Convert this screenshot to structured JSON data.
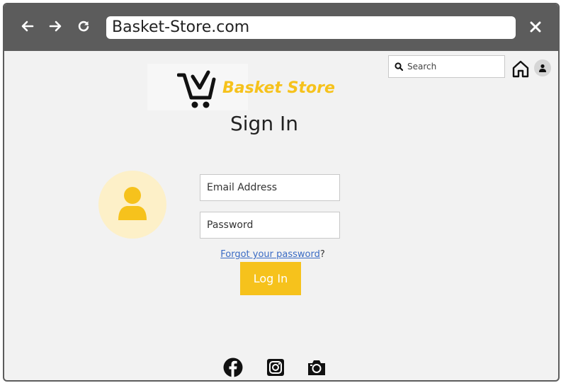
{
  "browser": {
    "url": "Basket-Store.com",
    "back_icon": "arrow-left-icon",
    "forward_icon": "arrow-right-icon",
    "reload_icon": "reload-icon",
    "close_icon": "close-icon"
  },
  "header": {
    "search_placeholder": "Search",
    "search_icon": "search-icon",
    "home_icon": "home-icon",
    "account_icon": "user-icon"
  },
  "brand": {
    "name": "Basket Store",
    "logo_icon": "shopping-cart-icon",
    "color": "#f6c21c"
  },
  "signin": {
    "title": "Sign In",
    "email_placeholder": "Email Address",
    "password_placeholder": "Password",
    "forgot_link": "Forgot your password",
    "forgot_suffix": "?",
    "login_label": "Log In",
    "avatar_icon": "user-avatar-icon"
  },
  "footer": {
    "social": [
      "facebook-icon",
      "instagram-icon",
      "camera-icon"
    ]
  },
  "colors": {
    "chrome": "#5c5c5c",
    "page_bg": "#f2f2f2",
    "accent": "#f6c21c",
    "avatar_bg": "#fdf0c8",
    "link": "#3a6bc4"
  }
}
